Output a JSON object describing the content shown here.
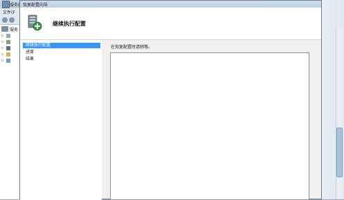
{
  "background_app": {
    "title": "服务器...",
    "menu_file": "文件(F",
    "tree_root_label": "服务"
  },
  "dialog": {
    "title": "恢复配置向导",
    "header_title": "继续执行配置",
    "icon": "server-restore-icon",
    "nav_items": [
      {
        "label": "继续执行配置",
        "selected": true
      },
      {
        "label": "进度",
        "selected": false
      },
      {
        "label": "结果",
        "selected": false
      }
    ],
    "instruction": "在恢复配置时请稍等。"
  },
  "colors": {
    "selection": "#3399ff",
    "dialog_bg": "#f0f0f0",
    "header_bg": "#ffffff"
  }
}
